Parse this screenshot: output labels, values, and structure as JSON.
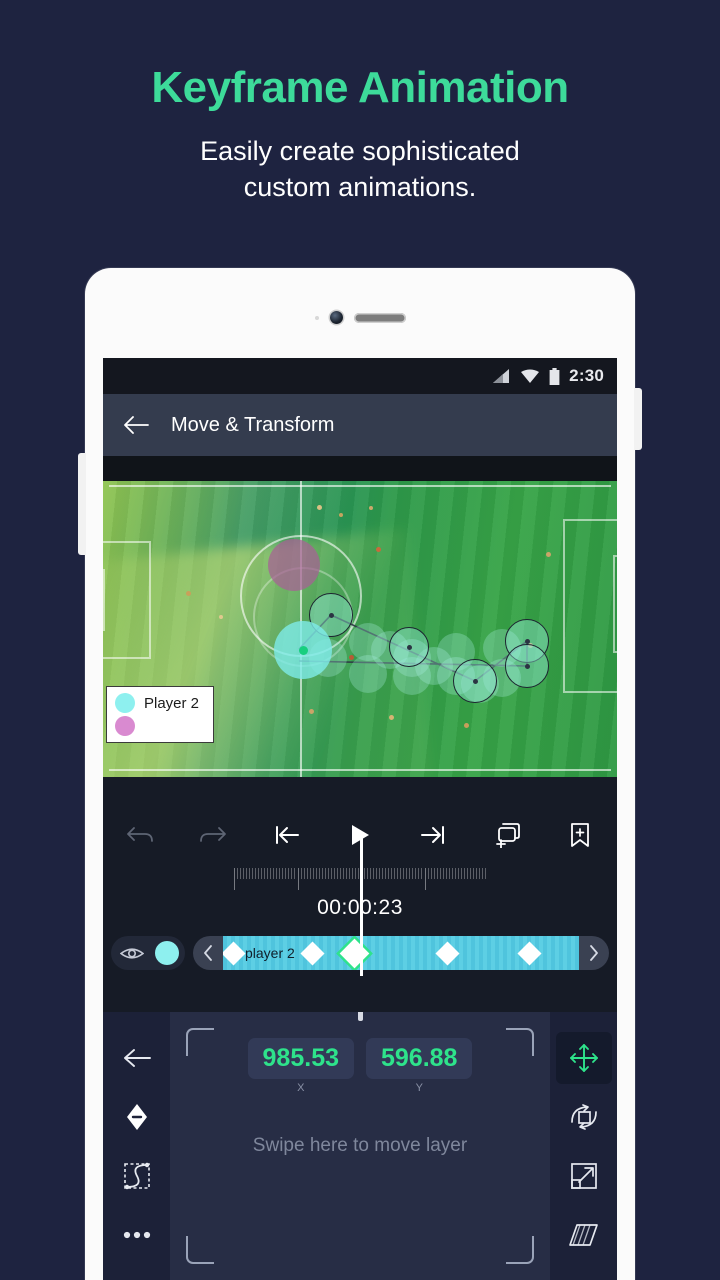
{
  "promo": {
    "title": "Keyframe Animation",
    "subtitle_line1": "Easily create sophisticated",
    "subtitle_line2": "custom animations."
  },
  "colors": {
    "page_background": "#1e2340",
    "accent_green": "#3ddb9a",
    "value_green": "#2ee38b",
    "track_cyan": "#4fc4dd",
    "layer_cyan": "#8ef0ef",
    "layer_pink": "#d98ad0",
    "appbar": "#343c4e",
    "screen_background": "#161b26",
    "panel_background": "#1c2138",
    "pad_background": "#272d45"
  },
  "device": {
    "sensor_icon": "proximity-sensor-dot",
    "camera_icon": "front-camera",
    "speaker_icon": "earpiece-speaker"
  },
  "statusbar": {
    "signal_icon": "cell-signal-icon",
    "wifi_icon": "wifi-icon",
    "battery_icon": "battery-icon",
    "time": "2:30"
  },
  "appbar": {
    "back_icon": "arrow-left-icon",
    "title": "Move & Transform"
  },
  "preview": {
    "legend": {
      "rows": [
        {
          "swatch": "#8ef0ef",
          "label": "Player 2"
        },
        {
          "swatch": "#d98ad0",
          "label": ""
        }
      ]
    },
    "motion_path": {
      "ghost_count": 12,
      "keyframe_nodes": 5
    }
  },
  "toolbar": {
    "buttons": [
      {
        "name": "undo-button",
        "icon": "undo-icon",
        "enabled": false
      },
      {
        "name": "redo-button",
        "icon": "redo-icon",
        "enabled": false
      },
      {
        "name": "skip-to-start-button",
        "icon": "skip-previous-icon",
        "enabled": true
      },
      {
        "name": "play-button",
        "icon": "play-icon",
        "enabled": true
      },
      {
        "name": "skip-to-end-button",
        "icon": "skip-next-icon",
        "enabled": true
      },
      {
        "name": "duplicate-layer-button",
        "icon": "duplicate-plus-icon",
        "enabled": true
      },
      {
        "name": "add-bookmark-button",
        "icon": "bookmark-plus-icon",
        "enabled": true
      }
    ]
  },
  "timeline": {
    "timecode": "00:00:23",
    "ruler_ticks": 84,
    "visibility": {
      "eye_icon": "eye-icon",
      "layer_color": "#8ef0ef"
    },
    "prev_keyframe_icon": "chevron-left-icon",
    "next_keyframe_icon": "chevron-right-icon",
    "clip": {
      "label": "player 2",
      "keyframes": [
        {
          "position_pct": 3,
          "selected": false
        },
        {
          "position_pct": 25,
          "selected": false
        },
        {
          "position_pct": 37,
          "selected": true
        },
        {
          "position_pct": 63,
          "selected": false
        },
        {
          "position_pct": 86,
          "selected": false
        }
      ]
    }
  },
  "transform_panel": {
    "left_buttons": [
      {
        "name": "back-button",
        "icon": "arrow-left-icon"
      },
      {
        "name": "delete-keyframe-button",
        "icon": "keyframe-minus-icon"
      },
      {
        "name": "easing-curve-button",
        "icon": "easing-curve-icon"
      },
      {
        "name": "more-options-button",
        "icon": "more-horizontal-icon"
      }
    ],
    "right_buttons": [
      {
        "name": "move-tool-button",
        "icon": "move-arrows-icon",
        "active": true
      },
      {
        "name": "rotate-tool-button",
        "icon": "rotate-icon",
        "active": false
      },
      {
        "name": "scale-tool-button",
        "icon": "scale-icon",
        "active": false
      },
      {
        "name": "skew-tool-button",
        "icon": "skew-icon",
        "active": false
      }
    ],
    "values": [
      {
        "value": "985.53",
        "axis": "X"
      },
      {
        "value": "596.88",
        "axis": "Y"
      }
    ],
    "hint": "Swipe here to move layer"
  }
}
